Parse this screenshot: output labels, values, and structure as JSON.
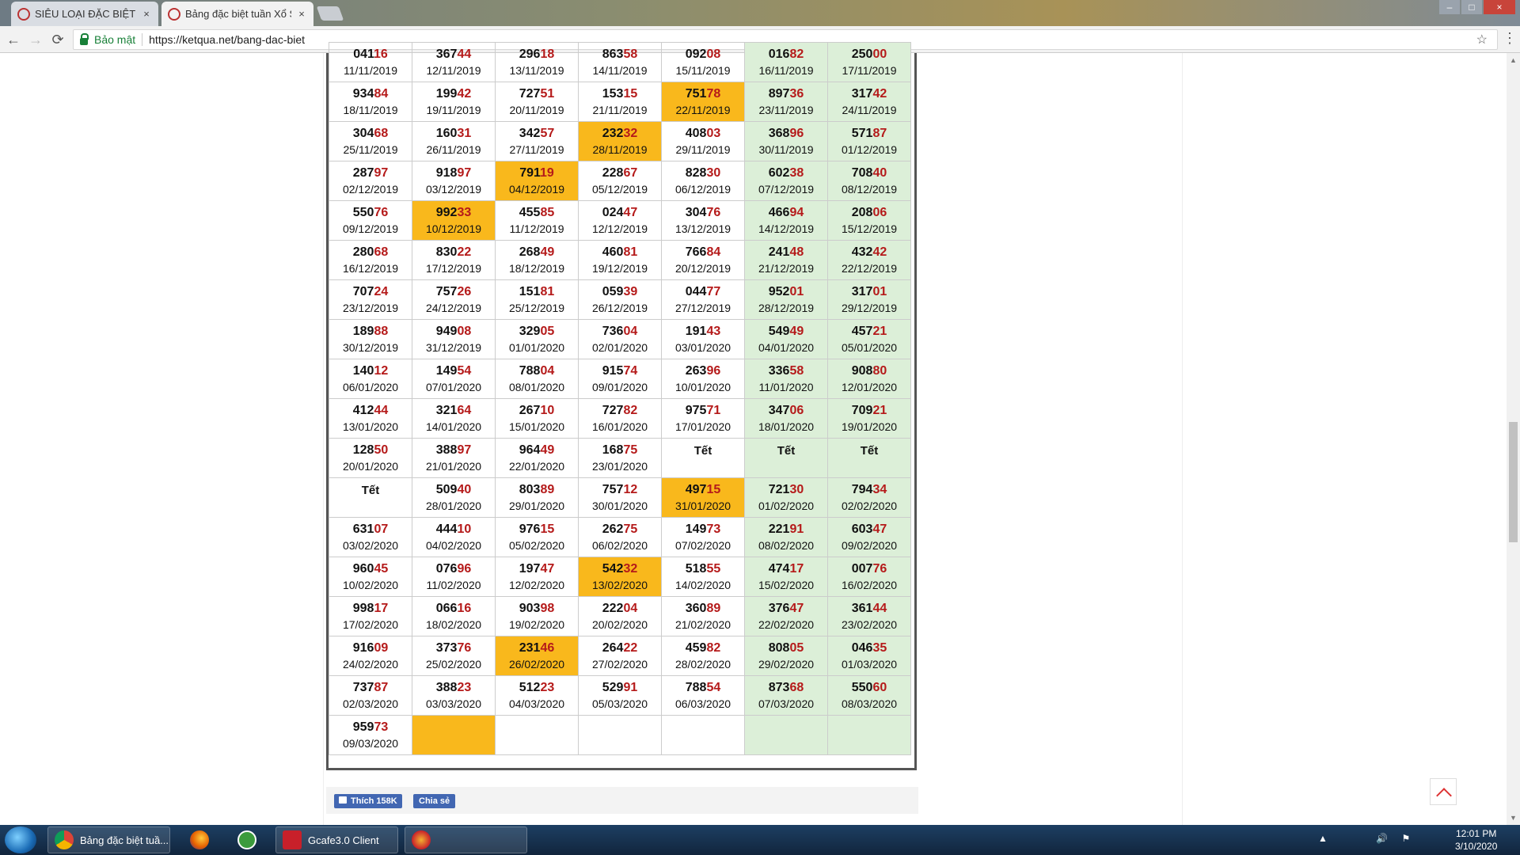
{
  "browser": {
    "tabs": [
      {
        "title": "SIÊU LOẠI ĐẶC BIỆT ( TỔ",
        "close": "×"
      },
      {
        "title": "Bảng đặc biệt tuần Xổ Số",
        "close": "×"
      }
    ],
    "secure_label": "Bảo mật",
    "url": "https://ketqua.net/bang-dac-biet",
    "back": "←",
    "forward": "→",
    "reload": "⟳",
    "bookmark": "☆",
    "menu": "⋮"
  },
  "table": {
    "rows": [
      [
        {
          "head": "041",
          "tail": "16",
          "date": "11/11/2019"
        },
        {
          "head": "367",
          "tail": "44",
          "date": "12/11/2019"
        },
        {
          "head": "296",
          "tail": "18",
          "date": "13/11/2019"
        },
        {
          "head": "863",
          "tail": "58",
          "date": "14/11/2019"
        },
        {
          "head": "092",
          "tail": "08",
          "date": "15/11/2019"
        },
        {
          "head": "016",
          "tail": "82",
          "date": "16/11/2019"
        },
        {
          "head": "250",
          "tail": "00",
          "date": "17/11/2019"
        }
      ],
      [
        {
          "head": "934",
          "tail": "84",
          "date": "18/11/2019"
        },
        {
          "head": "199",
          "tail": "42",
          "date": "19/11/2019"
        },
        {
          "head": "727",
          "tail": "51",
          "date": "20/11/2019"
        },
        {
          "head": "153",
          "tail": "15",
          "date": "21/11/2019"
        },
        {
          "head": "751",
          "tail": "78",
          "date": "22/11/2019",
          "hl": true
        },
        {
          "head": "897",
          "tail": "36",
          "date": "23/11/2019"
        },
        {
          "head": "317",
          "tail": "42",
          "date": "24/11/2019"
        }
      ],
      [
        {
          "head": "304",
          "tail": "68",
          "date": "25/11/2019"
        },
        {
          "head": "160",
          "tail": "31",
          "date": "26/11/2019"
        },
        {
          "head": "342",
          "tail": "57",
          "date": "27/11/2019"
        },
        {
          "head": "232",
          "tail": "32",
          "date": "28/11/2019",
          "hl": true
        },
        {
          "head": "408",
          "tail": "03",
          "date": "29/11/2019"
        },
        {
          "head": "368",
          "tail": "96",
          "date": "30/11/2019"
        },
        {
          "head": "571",
          "tail": "87",
          "date": "01/12/2019"
        }
      ],
      [
        {
          "head": "287",
          "tail": "97",
          "date": "02/12/2019"
        },
        {
          "head": "918",
          "tail": "97",
          "date": "03/12/2019"
        },
        {
          "head": "791",
          "tail": "19",
          "date": "04/12/2019",
          "hl": true
        },
        {
          "head": "228",
          "tail": "67",
          "date": "05/12/2019"
        },
        {
          "head": "828",
          "tail": "30",
          "date": "06/12/2019"
        },
        {
          "head": "602",
          "tail": "38",
          "date": "07/12/2019"
        },
        {
          "head": "708",
          "tail": "40",
          "date": "08/12/2019"
        }
      ],
      [
        {
          "head": "550",
          "tail": "76",
          "date": "09/12/2019"
        },
        {
          "head": "992",
          "tail": "33",
          "date": "10/12/2019",
          "hl": true
        },
        {
          "head": "455",
          "tail": "85",
          "date": "11/12/2019"
        },
        {
          "head": "024",
          "tail": "47",
          "date": "12/12/2019"
        },
        {
          "head": "304",
          "tail": "76",
          "date": "13/12/2019"
        },
        {
          "head": "466",
          "tail": "94",
          "date": "14/12/2019"
        },
        {
          "head": "208",
          "tail": "06",
          "date": "15/12/2019"
        }
      ],
      [
        {
          "head": "280",
          "tail": "68",
          "date": "16/12/2019"
        },
        {
          "head": "830",
          "tail": "22",
          "date": "17/12/2019"
        },
        {
          "head": "268",
          "tail": "49",
          "date": "18/12/2019"
        },
        {
          "head": "460",
          "tail": "81",
          "date": "19/12/2019"
        },
        {
          "head": "766",
          "tail": "84",
          "date": "20/12/2019"
        },
        {
          "head": "241",
          "tail": "48",
          "date": "21/12/2019"
        },
        {
          "head": "432",
          "tail": "42",
          "date": "22/12/2019"
        }
      ],
      [
        {
          "head": "707",
          "tail": "24",
          "date": "23/12/2019"
        },
        {
          "head": "757",
          "tail": "26",
          "date": "24/12/2019"
        },
        {
          "head": "151",
          "tail": "81",
          "date": "25/12/2019"
        },
        {
          "head": "059",
          "tail": "39",
          "date": "26/12/2019"
        },
        {
          "head": "044",
          "tail": "77",
          "date": "27/12/2019"
        },
        {
          "head": "952",
          "tail": "01",
          "date": "28/12/2019"
        },
        {
          "head": "317",
          "tail": "01",
          "date": "29/12/2019"
        }
      ],
      [
        {
          "head": "189",
          "tail": "88",
          "date": "30/12/2019"
        },
        {
          "head": "949",
          "tail": "08",
          "date": "31/12/2019"
        },
        {
          "head": "329",
          "tail": "05",
          "date": "01/01/2020"
        },
        {
          "head": "736",
          "tail": "04",
          "date": "02/01/2020"
        },
        {
          "head": "191",
          "tail": "43",
          "date": "03/01/2020"
        },
        {
          "head": "549",
          "tail": "49",
          "date": "04/01/2020"
        },
        {
          "head": "457",
          "tail": "21",
          "date": "05/01/2020"
        }
      ],
      [
        {
          "head": "140",
          "tail": "12",
          "date": "06/01/2020"
        },
        {
          "head": "149",
          "tail": "54",
          "date": "07/01/2020"
        },
        {
          "head": "788",
          "tail": "04",
          "date": "08/01/2020"
        },
        {
          "head": "915",
          "tail": "74",
          "date": "09/01/2020"
        },
        {
          "head": "263",
          "tail": "96",
          "date": "10/01/2020"
        },
        {
          "head": "336",
          "tail": "58",
          "date": "11/01/2020"
        },
        {
          "head": "908",
          "tail": "80",
          "date": "12/01/2020"
        }
      ],
      [
        {
          "head": "412",
          "tail": "44",
          "date": "13/01/2020"
        },
        {
          "head": "321",
          "tail": "64",
          "date": "14/01/2020"
        },
        {
          "head": "267",
          "tail": "10",
          "date": "15/01/2020"
        },
        {
          "head": "727",
          "tail": "82",
          "date": "16/01/2020"
        },
        {
          "head": "975",
          "tail": "71",
          "date": "17/01/2020"
        },
        {
          "head": "347",
          "tail": "06",
          "date": "18/01/2020"
        },
        {
          "head": "709",
          "tail": "21",
          "date": "19/01/2020"
        }
      ],
      [
        {
          "head": "128",
          "tail": "50",
          "date": "20/01/2020"
        },
        {
          "head": "388",
          "tail": "97",
          "date": "21/01/2020"
        },
        {
          "head": "964",
          "tail": "49",
          "date": "22/01/2020"
        },
        {
          "head": "168",
          "tail": "75",
          "date": "23/01/2020"
        },
        {
          "tet": "Tết"
        },
        {
          "tet": "Tết"
        },
        {
          "tet": "Tết"
        }
      ],
      [
        {
          "tet": "Tết"
        },
        {
          "head": "509",
          "tail": "40",
          "date": "28/01/2020"
        },
        {
          "head": "803",
          "tail": "89",
          "date": "29/01/2020"
        },
        {
          "head": "757",
          "tail": "12",
          "date": "30/01/2020"
        },
        {
          "head": "497",
          "tail": "15",
          "date": "31/01/2020",
          "hl": true
        },
        {
          "head": "721",
          "tail": "30",
          "date": "01/02/2020"
        },
        {
          "head": "794",
          "tail": "34",
          "date": "02/02/2020"
        }
      ],
      [
        {
          "head": "631",
          "tail": "07",
          "date": "03/02/2020"
        },
        {
          "head": "444",
          "tail": "10",
          "date": "04/02/2020"
        },
        {
          "head": "976",
          "tail": "15",
          "date": "05/02/2020"
        },
        {
          "head": "262",
          "tail": "75",
          "date": "06/02/2020"
        },
        {
          "head": "149",
          "tail": "73",
          "date": "07/02/2020"
        },
        {
          "head": "221",
          "tail": "91",
          "date": "08/02/2020"
        },
        {
          "head": "603",
          "tail": "47",
          "date": "09/02/2020"
        }
      ],
      [
        {
          "head": "960",
          "tail": "45",
          "date": "10/02/2020"
        },
        {
          "head": "076",
          "tail": "96",
          "date": "11/02/2020"
        },
        {
          "head": "197",
          "tail": "47",
          "date": "12/02/2020"
        },
        {
          "head": "542",
          "tail": "32",
          "date": "13/02/2020",
          "hl": true
        },
        {
          "head": "518",
          "tail": "55",
          "date": "14/02/2020"
        },
        {
          "head": "474",
          "tail": "17",
          "date": "15/02/2020"
        },
        {
          "head": "007",
          "tail": "76",
          "date": "16/02/2020"
        }
      ],
      [
        {
          "head": "998",
          "tail": "17",
          "date": "17/02/2020"
        },
        {
          "head": "066",
          "tail": "16",
          "date": "18/02/2020"
        },
        {
          "head": "903",
          "tail": "98",
          "date": "19/02/2020"
        },
        {
          "head": "222",
          "tail": "04",
          "date": "20/02/2020"
        },
        {
          "head": "360",
          "tail": "89",
          "date": "21/02/2020"
        },
        {
          "head": "376",
          "tail": "47",
          "date": "22/02/2020"
        },
        {
          "head": "361",
          "tail": "44",
          "date": "23/02/2020"
        }
      ],
      [
        {
          "head": "916",
          "tail": "09",
          "date": "24/02/2020"
        },
        {
          "head": "373",
          "tail": "76",
          "date": "25/02/2020"
        },
        {
          "head": "231",
          "tail": "46",
          "date": "26/02/2020",
          "hl": true
        },
        {
          "head": "264",
          "tail": "22",
          "date": "27/02/2020"
        },
        {
          "head": "459",
          "tail": "82",
          "date": "28/02/2020"
        },
        {
          "head": "808",
          "tail": "05",
          "date": "29/02/2020"
        },
        {
          "head": "046",
          "tail": "35",
          "date": "01/03/2020"
        }
      ],
      [
        {
          "head": "737",
          "tail": "87",
          "date": "02/03/2020"
        },
        {
          "head": "388",
          "tail": "23",
          "date": "03/03/2020"
        },
        {
          "head": "512",
          "tail": "23",
          "date": "04/03/2020"
        },
        {
          "head": "529",
          "tail": "91",
          "date": "05/03/2020"
        },
        {
          "head": "788",
          "tail": "54",
          "date": "06/03/2020"
        },
        {
          "head": "873",
          "tail": "68",
          "date": "07/03/2020"
        },
        {
          "head": "550",
          "tail": "60",
          "date": "08/03/2020"
        }
      ],
      [
        {
          "head": "959",
          "tail": "73",
          "date": "09/03/2020"
        },
        {
          "empty": true,
          "hl": true
        },
        {
          "empty": true
        },
        {
          "empty": true
        },
        {
          "empty": true
        },
        {
          "empty": true
        },
        {
          "empty": true
        }
      ]
    ]
  },
  "social": {
    "like": "Thích 158K",
    "share": "Chia sẻ"
  },
  "taskbar": {
    "items": [
      {
        "label": "Bảng đặc biệt tuầ..."
      },
      {
        "label": "Gcafe3.0 Client"
      }
    ],
    "time": "12:01 PM",
    "date": "3/10/2020"
  },
  "colors": {
    "highlight": "#f9b81c",
    "weekend": "#dcefd8",
    "tail": "#b51a1a"
  }
}
